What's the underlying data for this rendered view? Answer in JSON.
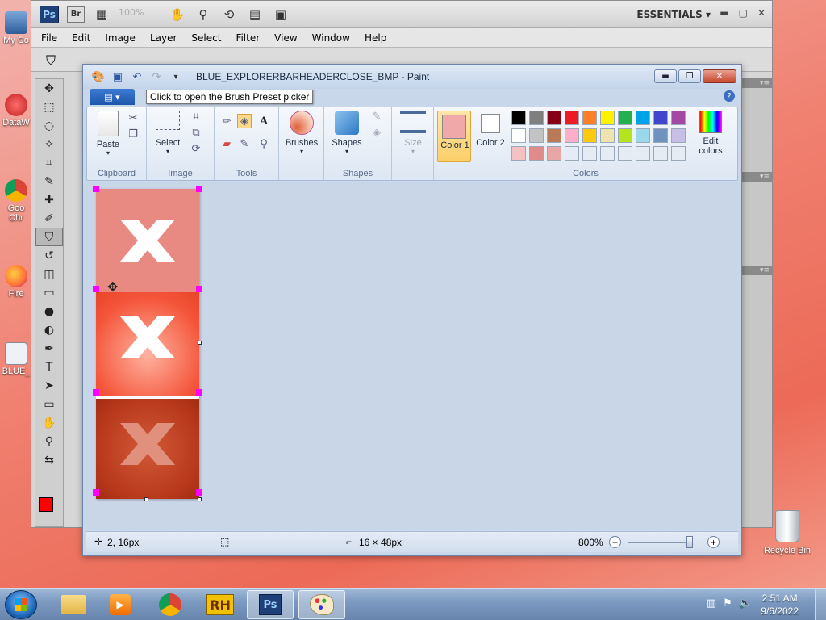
{
  "desktop": {
    "icons": [
      "My Co",
      "DataW",
      "Goo Chr",
      "Fire",
      "BLUE_"
    ],
    "recycle_bin": "Recycle Bin"
  },
  "photoshop": {
    "logo": "Ps",
    "bridge": "Br",
    "zoom_value": "100%",
    "workspace": "ESSENTIALS",
    "menu": [
      "File",
      "Edit",
      "Image",
      "Layer",
      "Select",
      "Filter",
      "View",
      "Window",
      "Help"
    ],
    "fg_color": "#ff0000",
    "bg_color": "#ffffff"
  },
  "paint": {
    "title": "BLUE_EXPLORERBARHEADERCLOSE_BMP - Paint",
    "tooltip": "Click to open the Brush Preset picker",
    "ribbon": {
      "clipboard": {
        "label": "Clipboard",
        "paste": "Paste"
      },
      "image": {
        "label": "Image",
        "select": "Select"
      },
      "tools": {
        "label": "Tools"
      },
      "brushes": "Brushes",
      "shapes": {
        "label": "Shapes",
        "shapes_btn": "Shapes"
      },
      "size": "Size",
      "colors": {
        "label": "Colors",
        "color1": "Color 1",
        "color2": "Color 2",
        "edit_colors": "Edit colors",
        "color1_value": "#f0a8a8",
        "color2_value": "#ffffff",
        "palette_row1": [
          "#000000",
          "#7f7f7f",
          "#880015",
          "#ed1c24",
          "#ff7f27",
          "#fff200",
          "#22b14c",
          "#00a2e8",
          "#3f48cc",
          "#a349a4"
        ],
        "palette_row2": [
          "#ffffff",
          "#c3c3c3",
          "#b97a57",
          "#ffaec9",
          "#ffc90e",
          "#efe4b0",
          "#b5e61d",
          "#99d9ea",
          "#7092be",
          "#c8bfe7"
        ],
        "palette_row3": [
          "#f4c2c2",
          "#e08a8a",
          "#e9a6a6",
          "#e6ecf4",
          "#e6ecf4",
          "#e6ecf4",
          "#e6ecf4",
          "#e6ecf4",
          "#e6ecf4",
          "#e6ecf4"
        ]
      }
    },
    "status": {
      "cursor_pos": "2, 16px",
      "selection_size": "",
      "image_size": "16 × 48px",
      "zoom": "800%"
    }
  },
  "taskbar": {
    "time": "2:51 AM",
    "date": "9/6/2022",
    "items": [
      "explorer",
      "media-player",
      "chrome",
      "rh",
      "photoshop",
      "paint"
    ]
  }
}
